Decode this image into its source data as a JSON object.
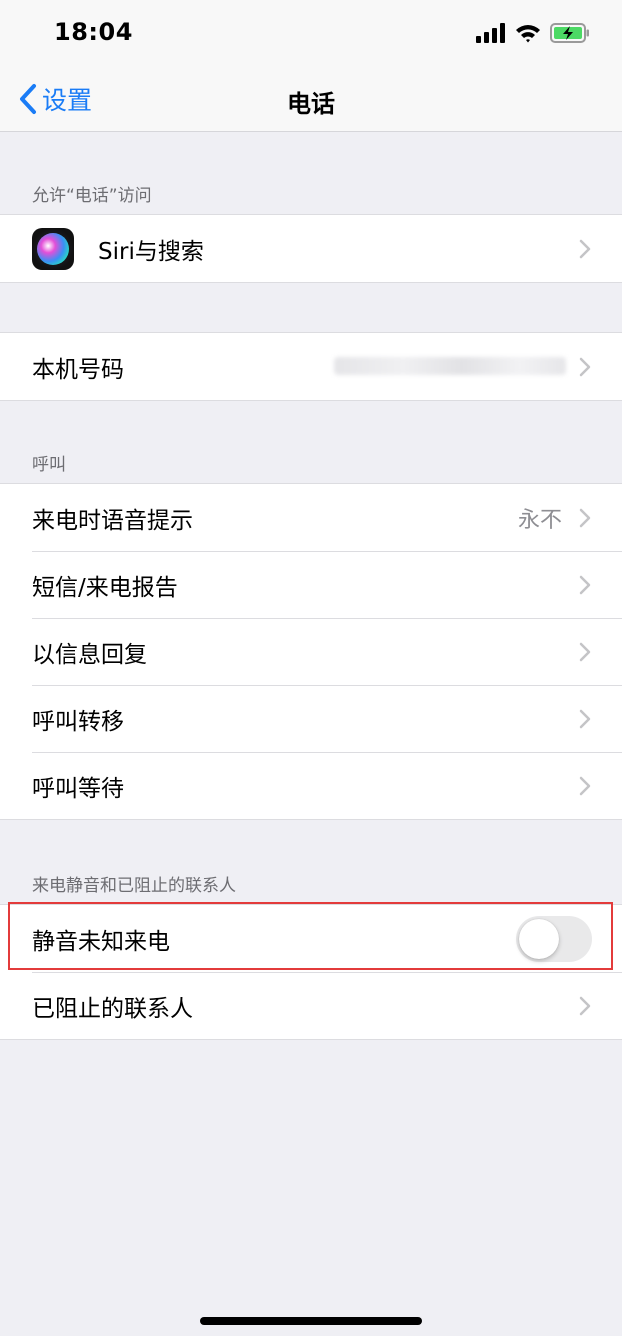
{
  "status_bar": {
    "time": "18:04",
    "icons": [
      "signal-icon",
      "wifi-icon",
      "battery-charging-icon"
    ],
    "battery_color": "#4cd964"
  },
  "nav": {
    "back_label": "设置",
    "title": "电话",
    "accent_color": "#1a7cf6"
  },
  "sections": {
    "allow_access_header": "允许“电话”访问",
    "siri_row": {
      "label": "Siri与搜索",
      "icon": "siri-icon"
    },
    "my_number_row": {
      "label": "本机号码"
    },
    "calls_header": "呼叫",
    "calls": [
      {
        "label": "来电时语音提示",
        "value": "永不"
      },
      {
        "label": "短信/来电报告"
      },
      {
        "label": "以信息回复"
      },
      {
        "label": "呼叫转移"
      },
      {
        "label": "呼叫等待"
      }
    ],
    "silence_header": "来电静音和已阻止的联系人",
    "silence_unknown": {
      "label": "静音未知来电",
      "toggle_on": false
    },
    "blocked_row": {
      "label": "已阻止的联系人"
    }
  },
  "highlight_color": "#e33b3b"
}
